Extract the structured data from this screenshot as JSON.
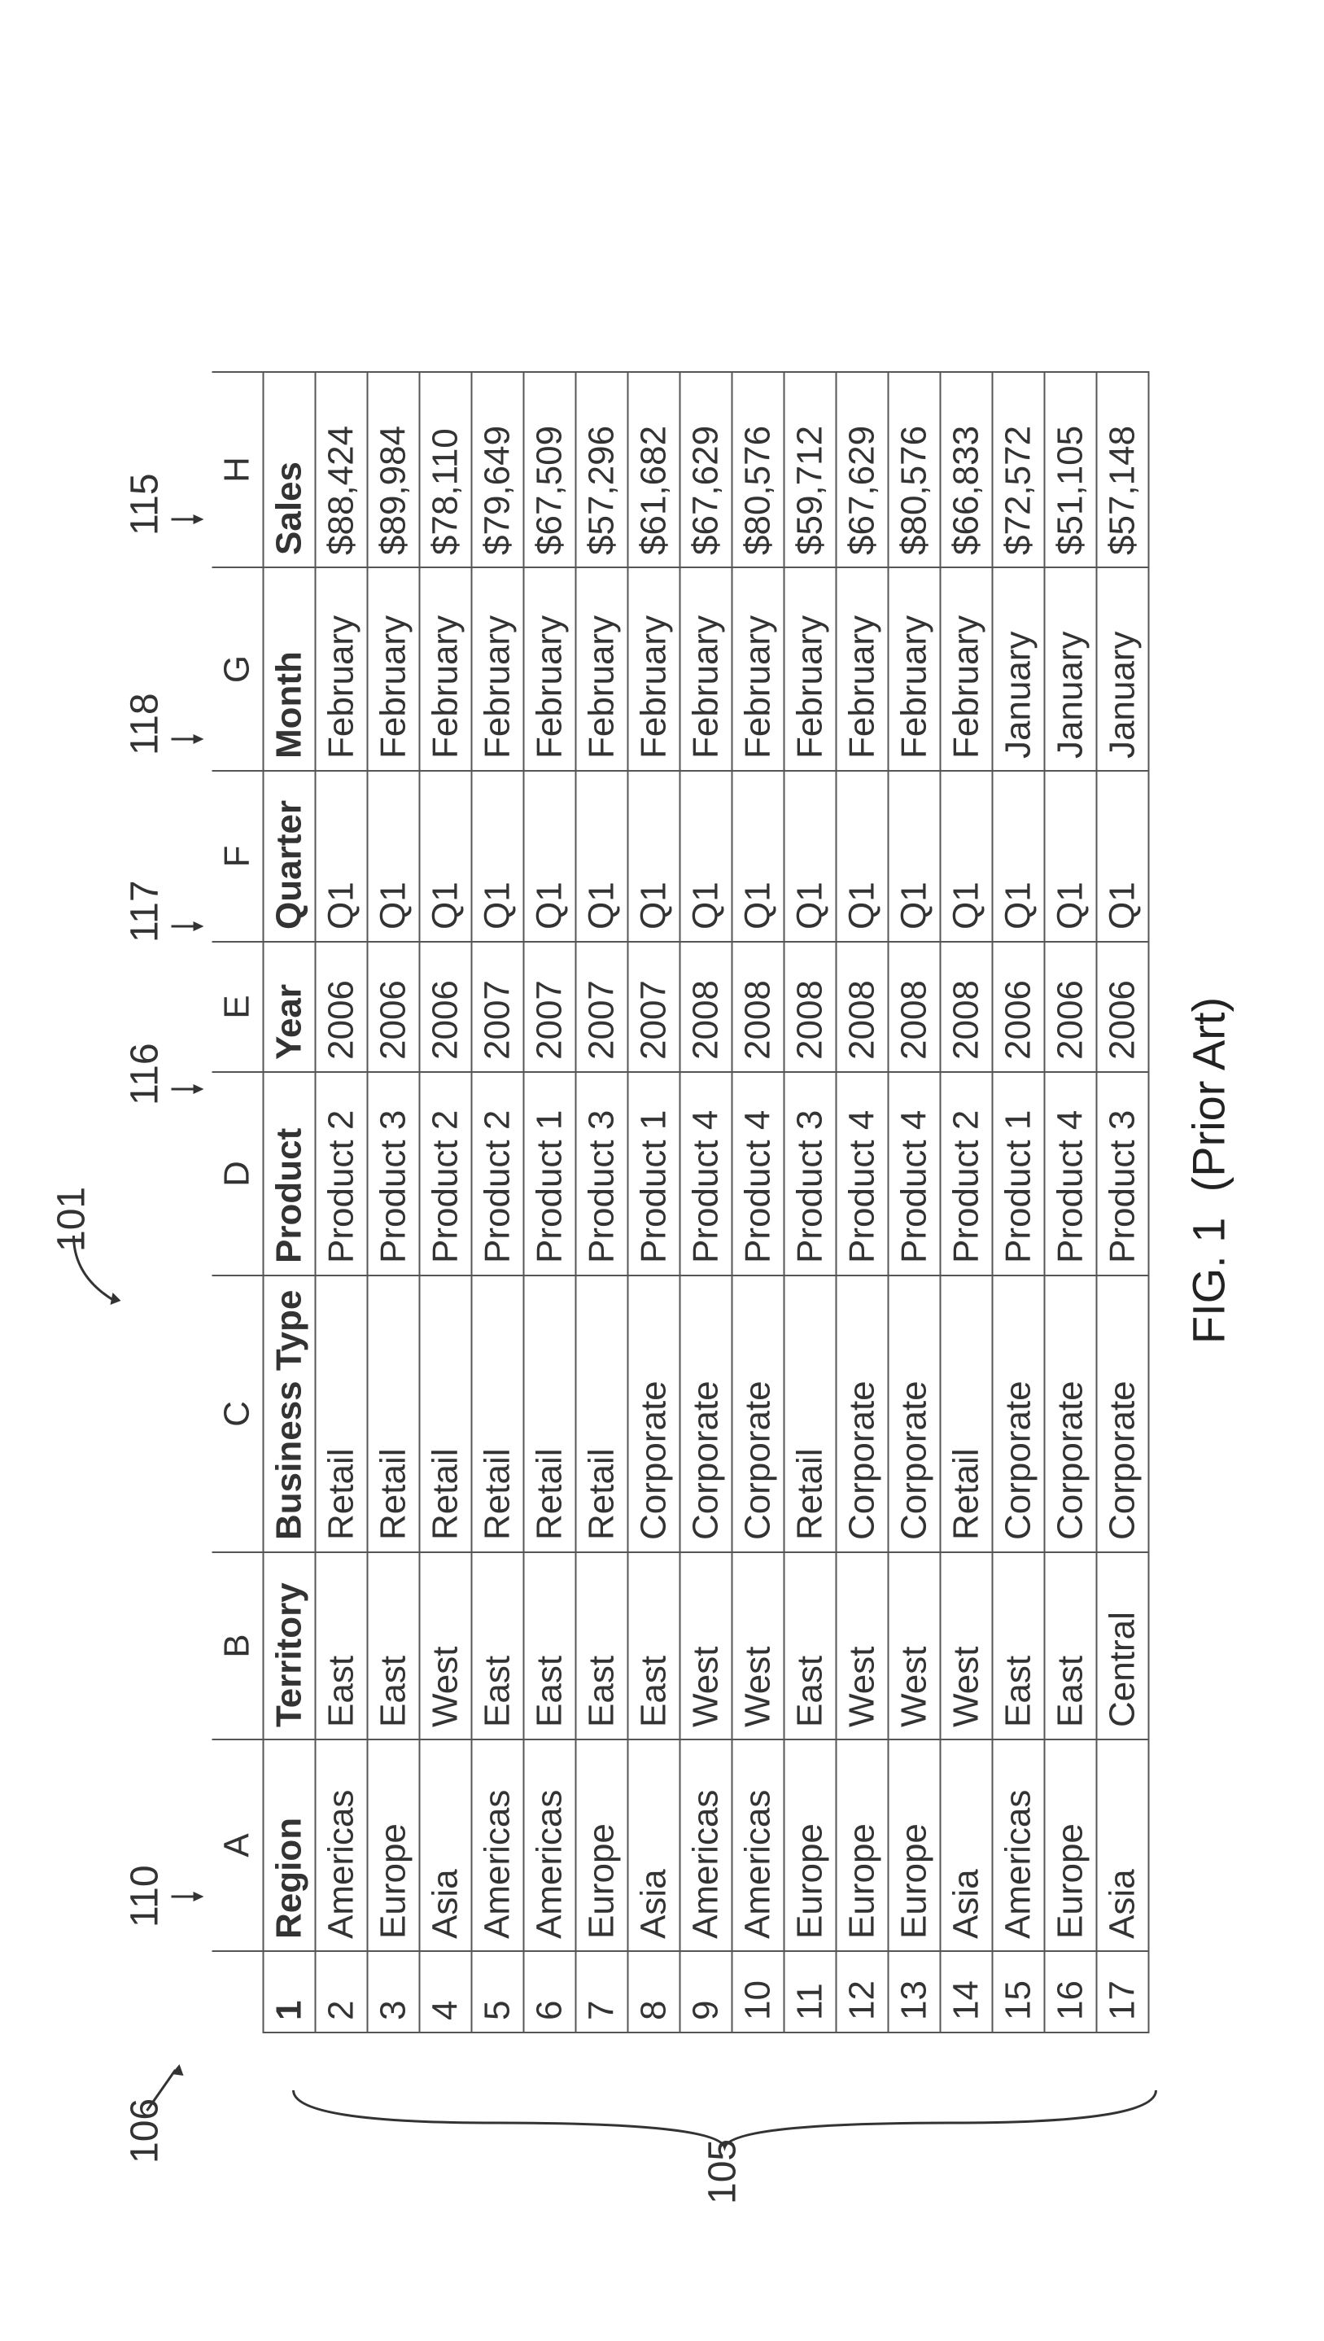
{
  "figure_label": "FIG. 1",
  "figure_note": "(Prior Art)",
  "callouts": {
    "fig": "101",
    "row_header": "106",
    "rows_brace": "105",
    "col_A": "110",
    "col_E": "116",
    "col_F": "117",
    "col_G": "118",
    "col_H": "115"
  },
  "columns": [
    "A",
    "B",
    "C",
    "D",
    "E",
    "F",
    "G",
    "H"
  ],
  "headers": {
    "A": "Region",
    "B": "Territory",
    "C": "Business Type",
    "D": "Product",
    "E": "Year",
    "F": "Quarter",
    "G": "Month",
    "H": "Sales"
  },
  "rows": [
    {
      "n": "2",
      "A": "Americas",
      "B": "East",
      "C": "Retail",
      "D": "Product 2",
      "E": "2006",
      "F": "Q1",
      "G": "February",
      "H": "$88,424"
    },
    {
      "n": "3",
      "A": "Europe",
      "B": "East",
      "C": "Retail",
      "D": "Product 3",
      "E": "2006",
      "F": "Q1",
      "G": "February",
      "H": "$89,984"
    },
    {
      "n": "4",
      "A": "Asia",
      "B": "West",
      "C": "Retail",
      "D": "Product 2",
      "E": "2006",
      "F": "Q1",
      "G": "February",
      "H": "$78,110"
    },
    {
      "n": "5",
      "A": "Americas",
      "B": "East",
      "C": "Retail",
      "D": "Product 2",
      "E": "2007",
      "F": "Q1",
      "G": "February",
      "H": "$79,649"
    },
    {
      "n": "6",
      "A": "Americas",
      "B": "East",
      "C": "Retail",
      "D": "Product 1",
      "E": "2007",
      "F": "Q1",
      "G": "February",
      "H": "$67,509"
    },
    {
      "n": "7",
      "A": "Europe",
      "B": "East",
      "C": "Retail",
      "D": "Product 3",
      "E": "2007",
      "F": "Q1",
      "G": "February",
      "H": "$57,296"
    },
    {
      "n": "8",
      "A": "Asia",
      "B": "East",
      "C": "Corporate",
      "D": "Product 1",
      "E": "2007",
      "F": "Q1",
      "G": "February",
      "H": "$61,682"
    },
    {
      "n": "9",
      "A": "Americas",
      "B": "West",
      "C": "Corporate",
      "D": "Product 4",
      "E": "2008",
      "F": "Q1",
      "G": "February",
      "H": "$67,629"
    },
    {
      "n": "10",
      "A": "Americas",
      "B": "West",
      "C": "Corporate",
      "D": "Product 4",
      "E": "2008",
      "F": "Q1",
      "G": "February",
      "H": "$80,576"
    },
    {
      "n": "11",
      "A": "Europe",
      "B": "East",
      "C": "Retail",
      "D": "Product 3",
      "E": "2008",
      "F": "Q1",
      "G": "February",
      "H": "$59,712"
    },
    {
      "n": "12",
      "A": "Europe",
      "B": "West",
      "C": "Corporate",
      "D": "Product 4",
      "E": "2008",
      "F": "Q1",
      "G": "February",
      "H": "$67,629"
    },
    {
      "n": "13",
      "A": "Europe",
      "B": "West",
      "C": "Corporate",
      "D": "Product 4",
      "E": "2008",
      "F": "Q1",
      "G": "February",
      "H": "$80,576"
    },
    {
      "n": "14",
      "A": "Asia",
      "B": "West",
      "C": "Retail",
      "D": "Product 2",
      "E": "2008",
      "F": "Q1",
      "G": "February",
      "H": "$66,833"
    },
    {
      "n": "15",
      "A": "Americas",
      "B": "East",
      "C": "Corporate",
      "D": "Product 1",
      "E": "2006",
      "F": "Q1",
      "G": "January",
      "H": "$72,572"
    },
    {
      "n": "16",
      "A": "Europe",
      "B": "East",
      "C": "Corporate",
      "D": "Product 4",
      "E": "2006",
      "F": "Q1",
      "G": "January",
      "H": "$51,105"
    },
    {
      "n": "17",
      "A": "Asia",
      "B": "Central",
      "C": "Corporate",
      "D": "Product 3",
      "E": "2006",
      "F": "Q1",
      "G": "January",
      "H": "$57,148"
    }
  ]
}
